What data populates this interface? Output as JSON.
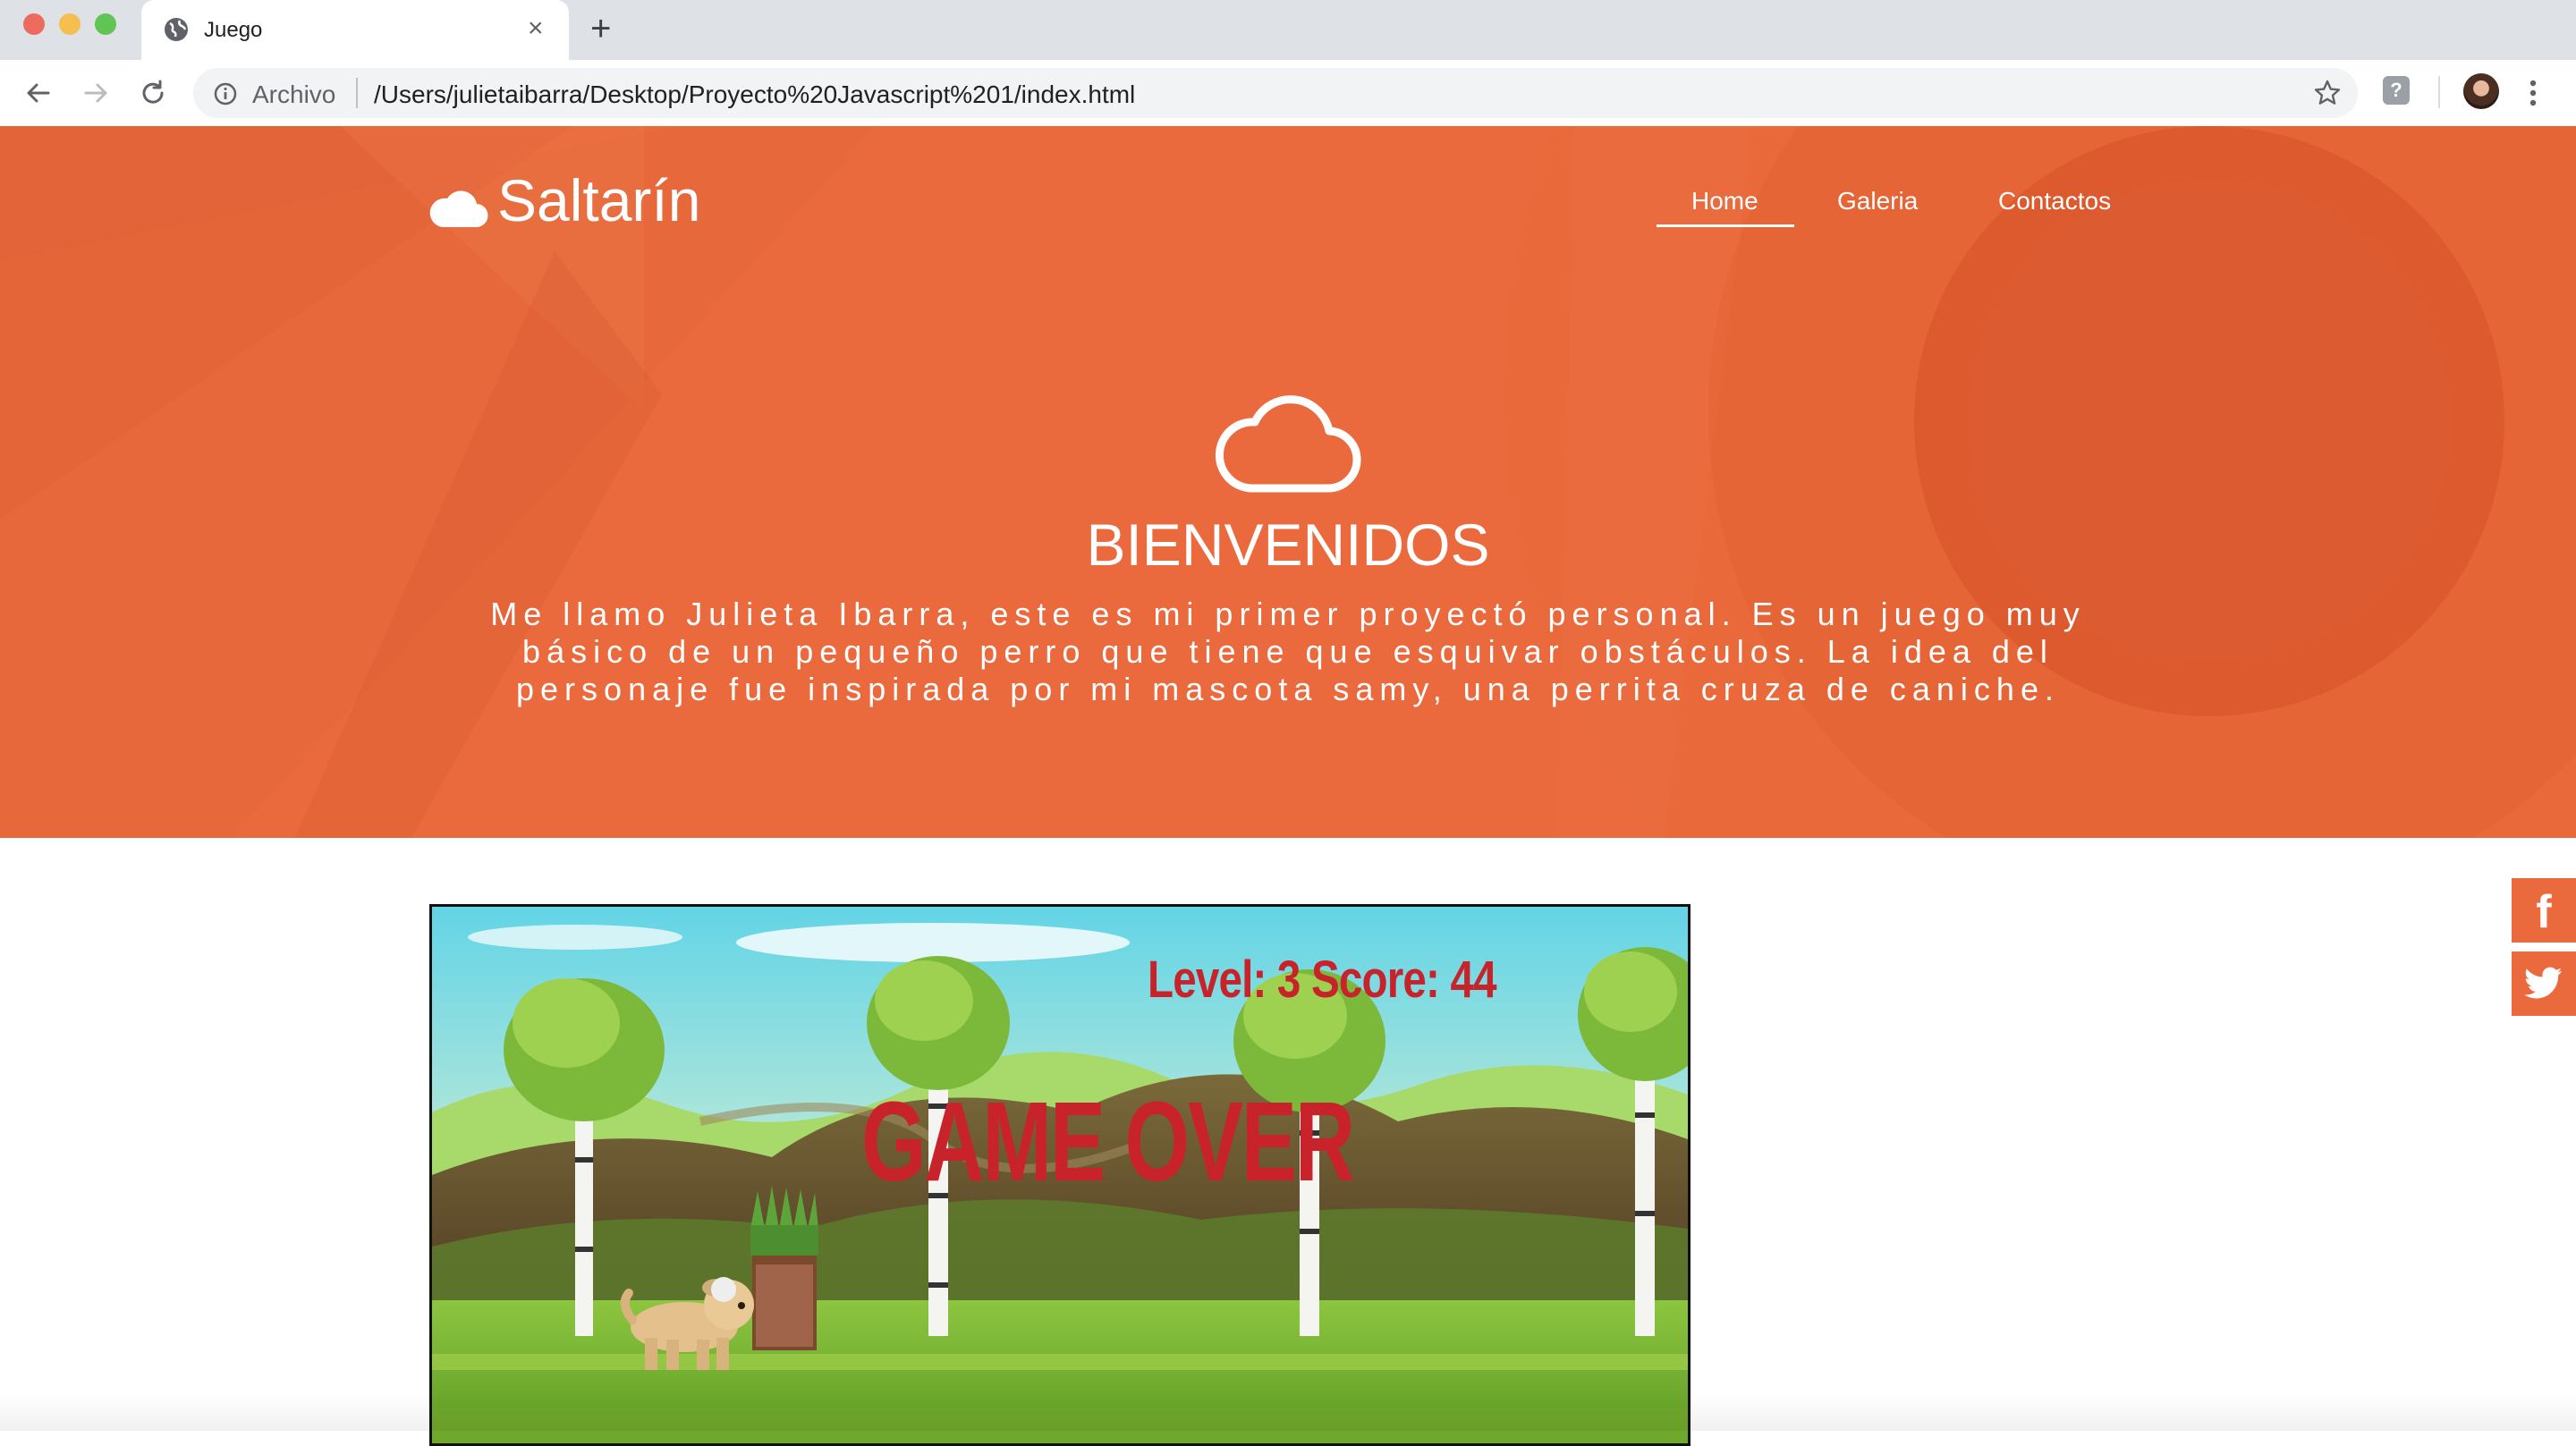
{
  "browser": {
    "tab_title": "Juego",
    "address_label": "Archivo",
    "url": "/Users/julietaibarra/Desktop/Proyecto%20Javascript%201/index.html"
  },
  "site": {
    "logo": "Saltarín",
    "nav": [
      "Home",
      "Galeria",
      "Contactos"
    ],
    "active_nav": "Home",
    "accent_color": "#ea6a3d"
  },
  "hero": {
    "heading": "BIENVENIDOS",
    "intro": "Me llamo Julieta Ibarra, este es mi primer proyectó personal. Es un juego muy básico de un pequeño perro que tiene que esquivar obstáculos. La idea del personaje fue inspirada por mi mascota samy, una perrita cruza de caniche."
  },
  "social": [
    "facebook-icon",
    "twitter-icon"
  ],
  "game": {
    "hud": "Level: 3  Score: 44",
    "status": "GAME OVER"
  }
}
